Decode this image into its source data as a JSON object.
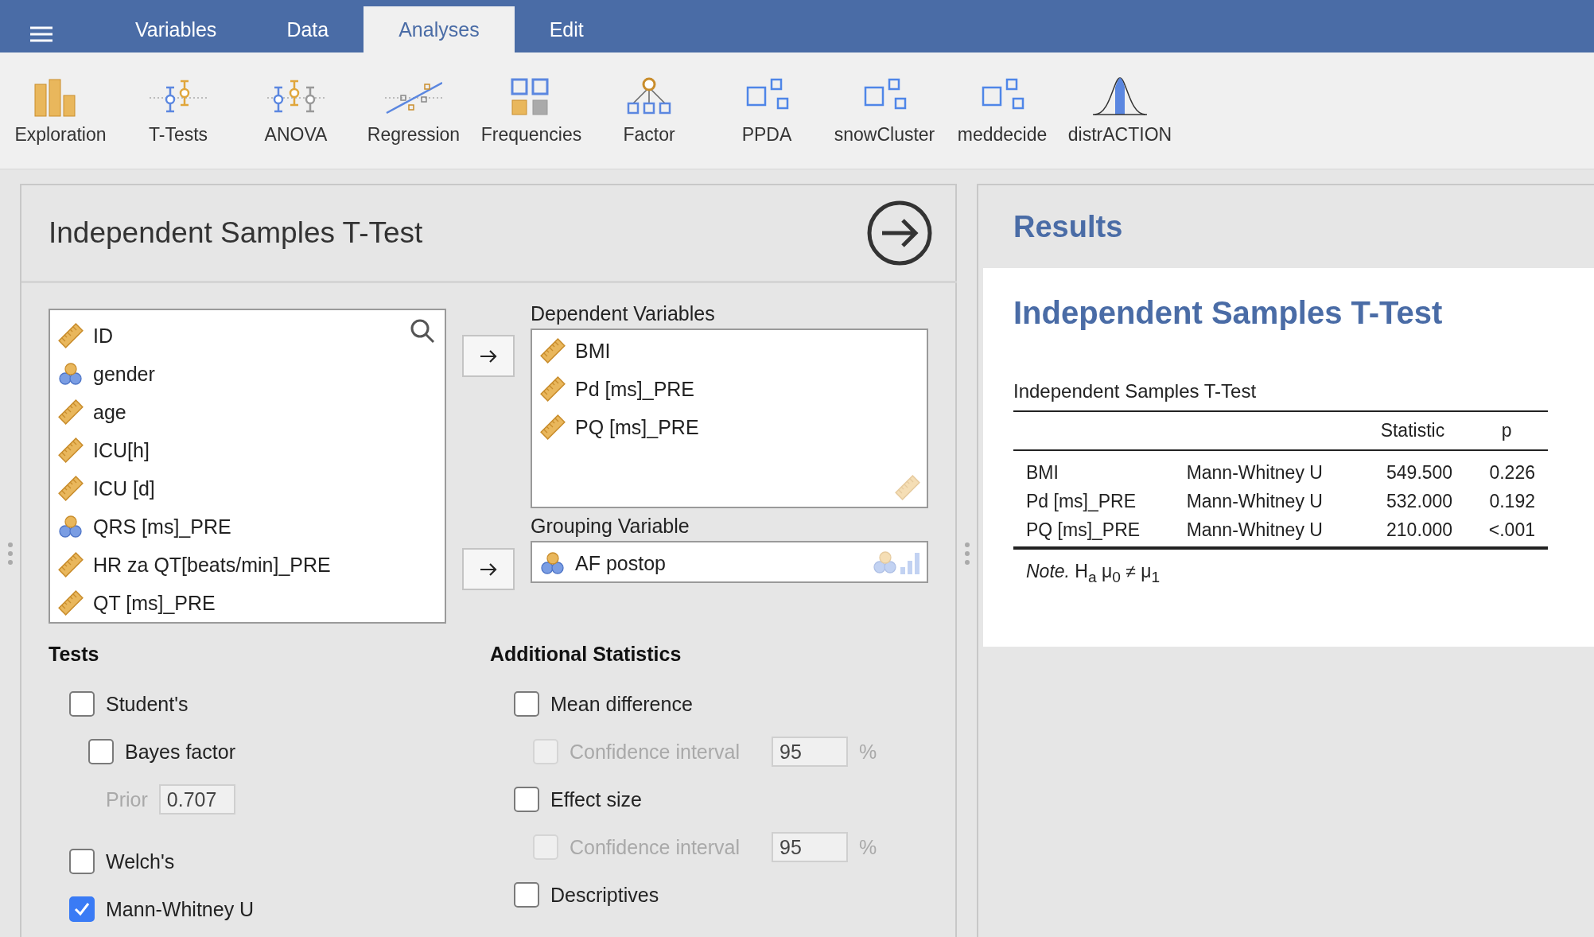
{
  "menu_tabs": [
    {
      "label": "Variables",
      "selected": false
    },
    {
      "label": "Data",
      "selected": false
    },
    {
      "label": "Analyses",
      "selected": true
    },
    {
      "label": "Edit",
      "selected": false
    }
  ],
  "ribbon": [
    {
      "label": "Exploration"
    },
    {
      "label": "T-Tests"
    },
    {
      "label": "ANOVA"
    },
    {
      "label": "Regression"
    },
    {
      "label": "Frequencies"
    },
    {
      "label": "Factor"
    },
    {
      "label": "PPDA"
    },
    {
      "label": "snowCluster"
    },
    {
      "label": "meddecide"
    },
    {
      "label": "distrACTION"
    }
  ],
  "options_panel": {
    "title": "Independent Samples T-Test",
    "variables": [
      {
        "name": "ID",
        "kind": "scale"
      },
      {
        "name": "gender",
        "kind": "nominal"
      },
      {
        "name": "age",
        "kind": "scale"
      },
      {
        "name": "ICU[h]",
        "kind": "scale"
      },
      {
        "name": "ICU [d]",
        "kind": "scale"
      },
      {
        "name": "QRS [ms]_PRE",
        "kind": "nominal"
      },
      {
        "name": "HR za QT[beats/min]_PRE",
        "kind": "scale"
      },
      {
        "name": "QT [ms]_PRE",
        "kind": "scale"
      }
    ],
    "dependent": {
      "label": "Dependent Variables",
      "variables": [
        {
          "name": "BMI",
          "kind": "scale"
        },
        {
          "name": "Pd [ms]_PRE",
          "kind": "scale"
        },
        {
          "name": "PQ [ms]_PRE",
          "kind": "scale"
        }
      ]
    },
    "grouping": {
      "label": "Grouping Variable",
      "variables": [
        {
          "name": "AF postop",
          "kind": "nominal"
        }
      ]
    },
    "tests": {
      "heading": "Tests",
      "items": [
        {
          "kind": "checkbox",
          "label": "Student's",
          "checked": false,
          "children": [
            {
              "kind": "checkbox",
              "label": "Bayes factor",
              "checked": false,
              "children": [
                {
                  "kind": "field",
                  "label": "Prior",
                  "value": "0.707",
                  "disabled": true
                }
              ]
            }
          ]
        },
        {
          "kind": "checkbox",
          "label": "Welch's",
          "checked": false
        },
        {
          "kind": "checkbox",
          "label": "Mann-Whitney U",
          "checked": true
        }
      ]
    },
    "additional": {
      "heading": "Additional Statistics",
      "items": [
        {
          "kind": "checkbox",
          "label": "Mean difference",
          "checked": false,
          "children": [
            {
              "kind": "ci",
              "label": "Confidence interval",
              "checked": false,
              "disabled": true,
              "value": "95",
              "unit": "%"
            }
          ]
        },
        {
          "kind": "checkbox",
          "label": "Effect size",
          "checked": false,
          "children": [
            {
              "kind": "ci",
              "label": "Confidence interval",
              "checked": false,
              "disabled": true,
              "value": "95",
              "unit": "%"
            }
          ]
        },
        {
          "kind": "checkbox",
          "label": "Descriptives",
          "checked": false
        }
      ]
    }
  },
  "results": {
    "heading": "Results",
    "title": "Independent Samples T-Test",
    "table": {
      "caption": "Independent Samples T-Test",
      "columns": [
        "",
        "",
        "Statistic",
        "p"
      ],
      "rows": [
        [
          "BMI",
          "Mann-Whitney U",
          "549.500",
          "0.226"
        ],
        [
          "Pd [ms]_PRE",
          "Mann-Whitney U",
          "532.000",
          "0.192"
        ],
        [
          "PQ [ms]_PRE",
          "Mann-Whitney U",
          "210.000",
          "<.001"
        ]
      ],
      "note": "*Note.* H$_{a}$ μ$_{0}$ ≠ μ$_{1}$"
    }
  }
}
